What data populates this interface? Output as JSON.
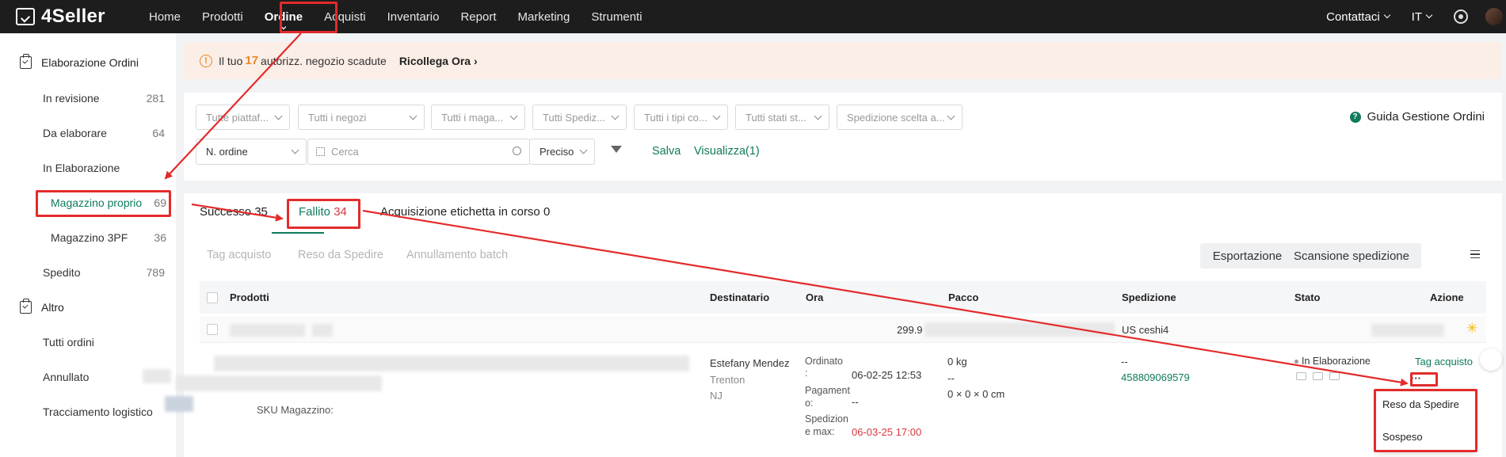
{
  "topbar": {
    "logo": "4Seller",
    "nav": [
      "Home",
      "Prodotti",
      "Ordine",
      "Acquisti",
      "Inventario",
      "Report",
      "Marketing",
      "Strumenti"
    ],
    "contacts": "Contattaci",
    "language": "IT"
  },
  "sidebar": {
    "group1": "Elaborazione Ordini",
    "group2": "Altro",
    "items": [
      {
        "label": "In revisione",
        "count": "281"
      },
      {
        "label": "Da elaborare",
        "count": "64"
      },
      {
        "label": "In Elaborazione",
        "count": ""
      },
      {
        "label": "Magazzino proprio",
        "count": "69"
      },
      {
        "label": "Magazzino 3PF",
        "count": "36"
      },
      {
        "label": "Spedito",
        "count": "789"
      },
      {
        "label": "Tutti ordini",
        "count": ""
      },
      {
        "label": "Annullato",
        "count": ""
      },
      {
        "label": "Tracciamento logistico",
        "count": ""
      }
    ]
  },
  "notice": {
    "prefix": "Il tuo",
    "count": "17",
    "suffix": "autorizz. negozio scadute",
    "link": "Ricollega Ora"
  },
  "filters": {
    "selects": [
      "Tutte piattaf...",
      "Tutti i negozi",
      "Tutti i maga...",
      "Tutti Spediz...",
      "Tutti i tipi co...",
      "Tutti stati st...",
      "Spedizione scelta a..."
    ],
    "order_field": "N. ordine",
    "search_placeholder": "Cerca",
    "match": "Preciso",
    "save": "Salva",
    "view": "Visualizza(1)",
    "guide": "Guida Gestione Ordini"
  },
  "tabs": [
    {
      "label": "Successo",
      "count": "35"
    },
    {
      "label": "Fallito",
      "count": "34"
    },
    {
      "label": "Acquisizione etichetta in corso",
      "count": "0"
    }
  ],
  "actions": {
    "tag": "Tag acquisto",
    "reso": "Reso da Spedire",
    "cancel": "Annullamento batch",
    "export": "Esportazione",
    "scan": "Scansione spedizione"
  },
  "table": {
    "headers": [
      "Prodotti",
      "Destinatario",
      "Ora",
      "Pacco",
      "Spedizione",
      "Stato",
      "Azione"
    ],
    "row1": {
      "amount": "299.9",
      "shipping": "US ceshi4"
    },
    "row2": {
      "name": "Estefany Mendez",
      "city": "Trenton",
      "state": "NJ",
      "sku": "SKU Magazzino:",
      "ordered_label": "Ordinato",
      "ordered_date": "06-02-25 12:53",
      "payment_label_a": "Pagament",
      "payment_label_b": "o:",
      "payment_value": "--",
      "ship_label_a": "Spedizion",
      "ship_label_b": "e max:",
      "ship_max": "06-03-25 17:00",
      "weight": "0 kg",
      "dash": "--",
      "dims": "0 × 0 × 0 cm",
      "track_dash": "--",
      "tracking": "458809069579",
      "status": "In Elaborazione",
      "action": "Tag acquisto",
      "more": "···",
      "colon": ":"
    }
  },
  "dropdown": [
    "Reso da Spedire",
    "Sospeso"
  ]
}
